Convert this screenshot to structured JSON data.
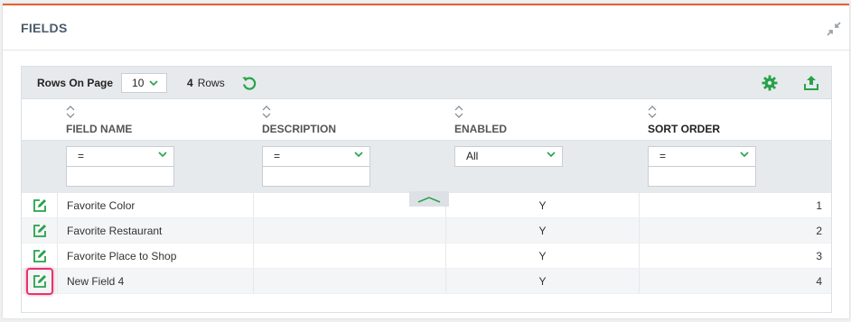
{
  "panel": {
    "title": "FIELDS"
  },
  "toolbar": {
    "rows_on_page_label": "Rows On Page",
    "rows_on_page_value": "10",
    "row_count_number": "4",
    "row_count_label": "Rows"
  },
  "columns": [
    {
      "label": "FIELD NAME"
    },
    {
      "label": "DESCRIPTION"
    },
    {
      "label": "ENABLED"
    },
    {
      "label": "SORT ORDER"
    }
  ],
  "filters": [
    {
      "operator": "="
    },
    {
      "operator": "="
    },
    {
      "operator": "All"
    },
    {
      "operator": "="
    }
  ],
  "rows": [
    {
      "field_name": "Favorite Color",
      "description": "",
      "enabled": "Y",
      "sort_order": "1"
    },
    {
      "field_name": "Favorite Restaurant",
      "description": "",
      "enabled": "Y",
      "sort_order": "2"
    },
    {
      "field_name": "Favorite Place to Shop",
      "description": "",
      "enabled": "Y",
      "sort_order": "3"
    },
    {
      "field_name": "New Field 4",
      "description": "",
      "enabled": "Y",
      "sort_order": "4"
    }
  ],
  "colors": {
    "accent": "#e8612c",
    "green": "#27a24a",
    "highlight": "#e8336a"
  },
  "icons": [
    "collapse-icon",
    "chevron-down-icon",
    "refresh-icon",
    "settings-icon",
    "export-icon",
    "sort-icon",
    "edit-icon",
    "chevron-up-icon"
  ]
}
